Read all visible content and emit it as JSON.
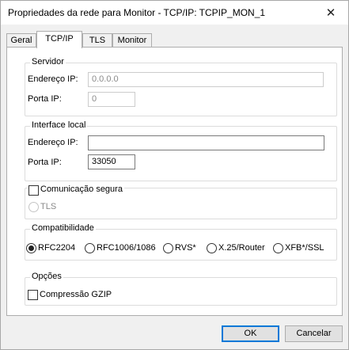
{
  "window": {
    "title": "Propriedades da rede para Monitor - TCP/IP: TCPIP_MON_1",
    "close_glyph": "✕"
  },
  "tabs": [
    {
      "label": "Geral"
    },
    {
      "label": "TCP/IP"
    },
    {
      "label": "TLS"
    },
    {
      "label": "Monitor"
    }
  ],
  "servidor": {
    "title": "Servidor",
    "address_label": "Endereço IP:",
    "address_value": "0.0.0.0",
    "port_label": "Porta IP:",
    "port_value": "0"
  },
  "interface_local": {
    "title": "Interface local",
    "address_label": "Endereço IP:",
    "address_value": "",
    "port_label": "Porta IP:",
    "port_value": "33050"
  },
  "seguranca": {
    "checkbox_label": "Comunicação segura",
    "tls_label": "TLS"
  },
  "compatibilidade": {
    "title": "Compatibilidade",
    "options": [
      {
        "label": "RFC2204"
      },
      {
        "label": "RFC1006/1086"
      },
      {
        "label": "RVS*"
      },
      {
        "label": "X.25/Router"
      },
      {
        "label": "XFB*/SSL"
      }
    ],
    "selected": "RFC2204"
  },
  "opcoes": {
    "title": "Opções",
    "gzip_label": "Compressão GZIP"
  },
  "buttons": {
    "ok": "OK",
    "cancel": "Cancelar"
  },
  "colors": {
    "default_button_border": "#0078d7",
    "panel": "#ffffff",
    "window": "#f0f0f0"
  },
  "icons": {
    "close": "close-icon"
  }
}
